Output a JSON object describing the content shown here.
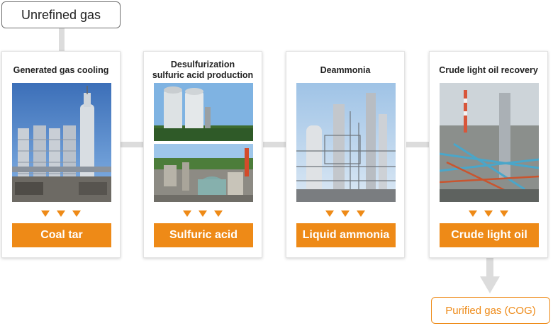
{
  "start": {
    "label": "Unrefined gas"
  },
  "steps": [
    {
      "title": "Generated gas cooling",
      "product": "Coal tar"
    },
    {
      "title": "Desulfurization\nsulfuric acid production",
      "product": "Sulfuric acid"
    },
    {
      "title": "Deammonia",
      "product": "Liquid ammonia"
    },
    {
      "title": "Crude light oil recovery",
      "product": "Crude light oil"
    }
  ],
  "end": {
    "label": "Purified gas (COG)"
  },
  "colors": {
    "accent": "#ee8a17",
    "connector": "#dcdcdc",
    "start_border": "#6f6f6f"
  },
  "icons": {
    "step_arrow": "orange-down-triangle",
    "flow_arrow": "gray-down-arrow"
  }
}
